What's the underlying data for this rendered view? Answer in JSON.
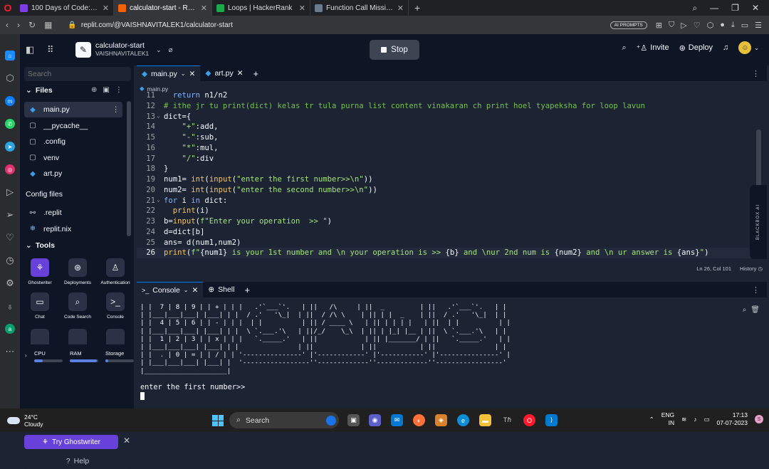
{
  "browser": {
    "tabs": [
      {
        "title": "100 Days of Code: The Com",
        "color": "#7b3fe4",
        "active": false
      },
      {
        "title": "calculator-start - Replit",
        "color": "#f26207",
        "active": true
      },
      {
        "title": "Loops | HackerRank",
        "color": "#1ba94c",
        "active": false
      },
      {
        "title": "Function Call Missing",
        "color": "#6a7b8c",
        "active": false
      }
    ],
    "url": "replit.com/@VAISHNAVITALEK1/calculator-start",
    "ai_prompts_label": "AI PROMPTS"
  },
  "header": {
    "repl_name": "calculator-start",
    "owner": "VAISHNAVITALEK1",
    "stop_label": "Stop",
    "invite_label": "Invite",
    "deploy_label": "Deploy"
  },
  "sidebar": {
    "search_placeholder": "Search",
    "files_title": "Files",
    "files": [
      {
        "name": "main.py",
        "icon": "python-icon",
        "selected": true
      },
      {
        "name": "__pycache__",
        "icon": "folder-icon",
        "selected": false
      },
      {
        "name": ".config",
        "icon": "folder-icon",
        "selected": false
      },
      {
        "name": "venv",
        "icon": "folder-icon",
        "selected": false
      },
      {
        "name": "art.py",
        "icon": "python-icon",
        "selected": false
      }
    ],
    "config_title": "Config files",
    "config_files": [
      {
        "name": ".replit",
        "icon": "replit-icon"
      },
      {
        "name": "replit.nix",
        "icon": "nix-icon"
      }
    ],
    "tools_title": "Tools",
    "tools": [
      {
        "label": "Ghostwriter",
        "icon": "ghostwriter-icon"
      },
      {
        "label": "Deployments",
        "icon": "deployments-icon"
      },
      {
        "label": "Authentication",
        "icon": "authentication-icon"
      },
      {
        "label": "Chat",
        "icon": "chat-icon"
      },
      {
        "label": "Code Search",
        "icon": "code-search-icon"
      },
      {
        "label": "Console",
        "icon": "console-icon"
      }
    ],
    "resources": [
      {
        "label": "CPU",
        "level": 0.3
      },
      {
        "label": "RAM",
        "level": 0.95
      },
      {
        "label": "Storage",
        "level": 0.1
      }
    ],
    "ghostwriter_button": "Try Ghostwriter",
    "help_label": "Help"
  },
  "editor": {
    "tabs": [
      "main.py",
      "art.py"
    ],
    "breadcrumb": "main.py",
    "lines": [
      {
        "n": "11",
        "fold": "",
        "html": "  <span class=\"kw\">return</span> n1/n2"
      },
      {
        "n": "12",
        "fold": "",
        "html": "<span class=\"cm\"># ithe jr tu print(dict) kelas tr tula purna list content vinakaran ch print hoel tyapeksha for loop lavun</span>"
      },
      {
        "n": "13",
        "fold": "⌄",
        "html": "dict={"
      },
      {
        "n": "14",
        "fold": "",
        "html": "    <span class=\"str\">\"+\"</span>:add,"
      },
      {
        "n": "15",
        "fold": "",
        "html": "    <span class=\"str\">\"-\"</span>:sub,"
      },
      {
        "n": "16",
        "fold": "",
        "html": "    <span class=\"str\">\"*\"</span>:mul,"
      },
      {
        "n": "17",
        "fold": "",
        "html": "    <span class=\"str\">\"/\"</span>:div"
      },
      {
        "n": "18",
        "fold": "",
        "html": "}"
      },
      {
        "n": "19",
        "fold": "",
        "html": "num1= <span class=\"fn\">int</span>(<span class=\"fn\">input</span>(<span class=\"str\">\"enter the first number>>\\n\"</span>))"
      },
      {
        "n": "20",
        "fold": "",
        "html": "num2= <span class=\"fn\">int</span>(<span class=\"fn\">input</span>(<span class=\"str\">\"enter the second number>>\\n\"</span>))"
      },
      {
        "n": "21",
        "fold": "⌄",
        "html": "<span class=\"kw\">for</span> i <span class=\"kw\">in</span> dict:"
      },
      {
        "n": "22",
        "fold": "",
        "html": "  <span class=\"fn\">print</span>(i)"
      },
      {
        "n": "23",
        "fold": "",
        "html": "b=<span class=\"fn\">input</span>(<span class=\"str\">f\"Enter your operation  >> \"</span>)"
      },
      {
        "n": "24",
        "fold": "",
        "html": "d=dict[b]"
      },
      {
        "n": "25",
        "fold": "",
        "html": "ans= d(num1,num2)"
      },
      {
        "n": "26",
        "fold": "",
        "html": "<span class=\"fn\">print</span>(<span class=\"str\">f\"</span><span class=\"ph\">{num1}</span><span class=\"str\"> is your 1st number and \\n your operation is >> </span><span class=\"ph\">{b}</span><span class=\"str\"> and \\nur 2nd num is </span><span class=\"ph\">{num2}</span><span class=\"str\"> and \\n ur answer is </span><span class=\"ph\">{ans}</span><span class=\"str\">\"</span>)"
      }
    ],
    "cursor_position": "Ln 26, Col 101",
    "history_label": "History",
    "blackbox_label": "BLACKBOX AI"
  },
  "console": {
    "tabs": [
      "Console",
      "Shell"
    ],
    "ascii_art": [
      "| |  7 | 8 | 9 | | + | | |   .'`___`'.   | ||   /\\     | ||  _         | ||   .'`___`'.   | |",
      "| |___|___|___| |___| | |  / .'   '\\_|  | ||  / /\\ \\    | || | |  _    | ||  / .'   '\\_|  | |",
      "| |  4 | 5 | 6 | | - | | |  | |          | || / ____ \\   | || | | | |   | ||  | |          | |",
      "| |___|___|___| |___| | |  \\ `.___.'\\   | ||/_/    \\_\\  | || | |_| |__ | ||  \\ `.___.'\\   | |",
      "| |  1 | 2 | 3 | | x | | |   `._____.'   | ||            | || |_______/ | ||   `._____.'   | |",
      "| |___|___|___| |___| | |               | ||            | ||           | ||               | |",
      "| |  . | 0 | = | | / | | '---------------' |'------------' |'-----------' |'---------------' |",
      "| |___|___|___| |___| |  '-----------------''-------------''-------------''-----------------'",
      "|_____________________|"
    ],
    "prompt_text": "enter the first number>>"
  },
  "taskbar": {
    "temperature": "24°C",
    "weather": "Cloudy",
    "search_label": "Search",
    "lang_top": "ENG",
    "lang_bottom": "IN",
    "time": "17:13",
    "date": "07-07-2023"
  }
}
